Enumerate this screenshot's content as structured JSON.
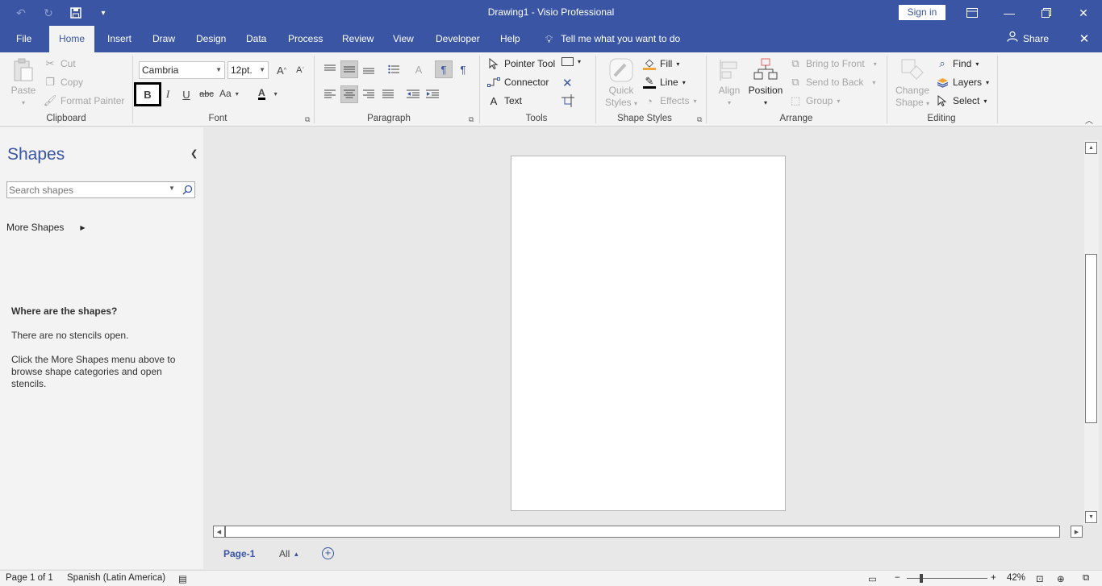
{
  "window": {
    "title": "Drawing1  -  Visio Professional",
    "sign_in": "Sign in"
  },
  "qat": {
    "undo_icon": "undo-icon",
    "redo_icon": "redo-icon",
    "save_icon": "save-icon",
    "customize_icon": "customize-qat-icon"
  },
  "tabs": [
    "File",
    "Home",
    "Insert",
    "Draw",
    "Design",
    "Data",
    "Process",
    "Review",
    "View",
    "Developer",
    "Help"
  ],
  "active_tab": "Home",
  "tell_me": "Tell me what you want to do",
  "share": "Share",
  "ribbon": {
    "clipboard": {
      "label": "Clipboard",
      "paste": "Paste",
      "cut": "Cut",
      "copy": "Copy",
      "format_painter": "Format Painter"
    },
    "font": {
      "label": "Font",
      "font_name": "Cambria",
      "font_size": "12pt.",
      "bold": "B",
      "italic": "I",
      "underline": "U",
      "strikethrough": "abc",
      "change_case": "Aa",
      "font_color": "A"
    },
    "paragraph": {
      "label": "Paragraph"
    },
    "tools": {
      "label": "Tools",
      "pointer": "Pointer Tool",
      "connector": "Connector",
      "text": "Text"
    },
    "shape_styles": {
      "label": "Shape Styles",
      "quick_styles_1": "Quick",
      "quick_styles_2": "Styles",
      "fill": "Fill",
      "line": "Line",
      "effects": "Effects"
    },
    "arrange": {
      "label": "Arrange",
      "align": "Align",
      "position": "Position",
      "bring_to_front": "Bring to Front",
      "send_to_back": "Send to Back",
      "group": "Group"
    },
    "editing": {
      "label": "Editing",
      "change_shape_1": "Change",
      "change_shape_2": "Shape",
      "find": "Find",
      "layers": "Layers",
      "select": "Select"
    }
  },
  "shapes_pane": {
    "title": "Shapes",
    "search_placeholder": "Search shapes",
    "more_shapes": "More Shapes",
    "info_title": "Where are the shapes?",
    "info_line1": "There are no stencils open.",
    "info_line2": "Click the More Shapes menu above to browse shape categories and open stencils."
  },
  "page_tabs": {
    "page": "Page-1",
    "all": "All"
  },
  "status": {
    "page_of": "Page 1 of 1",
    "language": "Spanish (Latin America)",
    "zoom": "42%"
  }
}
